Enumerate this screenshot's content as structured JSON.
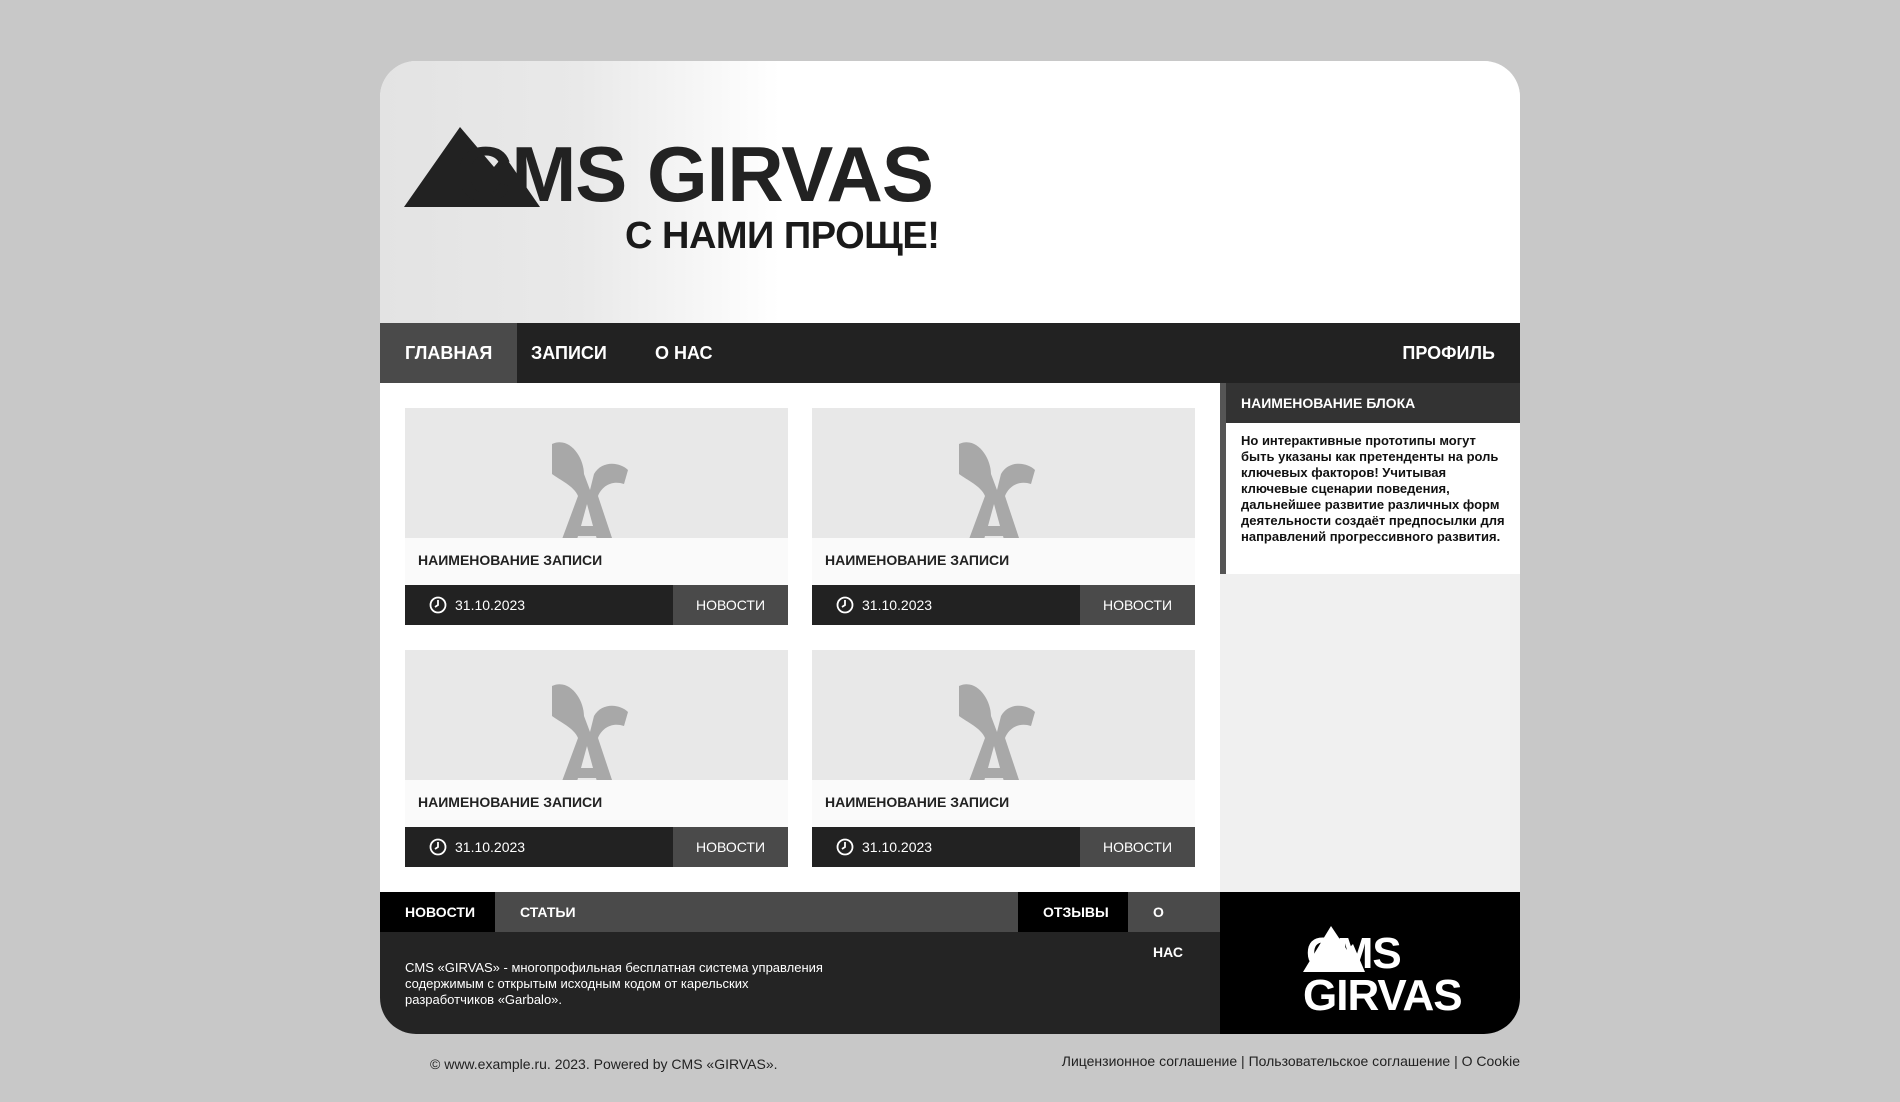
{
  "brand": {
    "logo_text": "CMS GIRVAS",
    "tagline": "С НАМИ ПРОЩЕ!"
  },
  "nav": {
    "items": [
      {
        "label": "ГЛАВНАЯ",
        "active": true
      },
      {
        "label": "ЗАПИСИ"
      },
      {
        "label": "О НАС"
      }
    ],
    "profile": "ПРОФИЛЬ"
  },
  "posts": [
    {
      "title": "НАИМЕНОВАНИЕ ЗАПИСИ",
      "date": "31.10.2023",
      "category": "НОВОСТИ"
    },
    {
      "title": "НАИМЕНОВАНИЕ ЗАПИСИ",
      "date": "31.10.2023",
      "category": "НОВОСТИ"
    },
    {
      "title": "НАИМЕНОВАНИЕ ЗАПИСИ",
      "date": "31.10.2023",
      "category": "НОВОСТИ"
    },
    {
      "title": "НАИМЕНОВАНИЕ ЗАПИСИ",
      "date": "31.10.2023",
      "category": "НОВОСТИ"
    }
  ],
  "sidebar": {
    "block_title": "НАИМЕНОВАНИЕ БЛОКА",
    "block_text": "Но интерактивные прототипы могут быть указаны как претенденты на роль ключевых факторов! Учитывая ключевые сценарии поведения, дальнейшее развитие различных форм деятельности создаёт предпосылки для направлений прогрессивного развития."
  },
  "footer": {
    "nav": [
      "НОВОСТИ",
      "СТАТЬИ",
      "ОТЗЫВЫ",
      "О НАС"
    ],
    "description": "CMS «GIRVAS» - многопрофильная бесплатная система управления содержимым с открытым исходным кодом от карельских разработчиков «Garbalo».",
    "logo_top": "CMS",
    "logo_bottom": "GIRVAS"
  },
  "copyright": "© www.example.ru. 2023. Powered by CMS «GIRVAS».",
  "legal": "Лицензионное соглашение | Пользовательское соглашение | О Cookie"
}
